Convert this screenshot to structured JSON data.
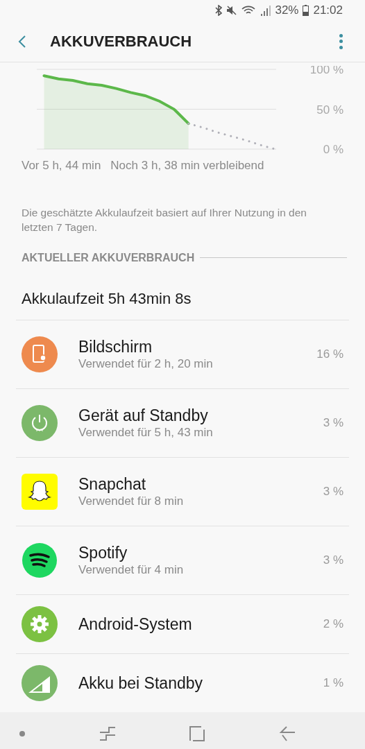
{
  "status_bar": {
    "battery": "32%",
    "time": "21:02"
  },
  "header": {
    "title": "AKKUVERBRAUCH"
  },
  "chart": {
    "chart_data": {
      "type": "line",
      "ylim": [
        0,
        100
      ],
      "yticks": [
        {
          "value": 100,
          "label": "100 %"
        },
        {
          "value": 50,
          "label": "50 %"
        },
        {
          "value": 0,
          "label": "0 %"
        }
      ],
      "series": [
        {
          "color": "#5cb84a",
          "values": [
            92,
            88,
            86,
            82,
            80,
            76,
            71,
            67,
            60,
            50,
            32,
            null,
            null,
            null,
            null,
            null,
            null
          ]
        },
        {
          "color": "#b0b0b8",
          "line_style": "dotted",
          "values": [
            null,
            null,
            null,
            null,
            null,
            null,
            null,
            null,
            null,
            null,
            32,
            27,
            21,
            16,
            11,
            5,
            0
          ]
        }
      ]
    },
    "start_label": "Vor 5 h, 44 min",
    "end_label": "Noch 3 h, 38 min verbleibend"
  },
  "note": "Die geschätzte Akkulaufzeit basiert auf Ihrer Nutzung in den letzten 7 Tagen.",
  "section_title": "AKTUELLER AKKUVERBRAUCH",
  "runtime": "Akkulaufzeit 5h 43min 8s",
  "apps": [
    {
      "kind": "display",
      "name": "Bildschirm",
      "usage": "Verwendet für 2 h, 20 min",
      "percent": "16 %"
    },
    {
      "kind": "power",
      "name": "Gerät auf Standby",
      "usage": "Verwendet für 5 h, 43 min",
      "percent": "3 %"
    },
    {
      "kind": "snapchat",
      "name": "Snapchat",
      "usage": "Verwendet für 8 min",
      "percent": "3 %"
    },
    {
      "kind": "spotify",
      "name": "Spotify",
      "usage": "Verwendet für 4 min",
      "percent": "3 %"
    },
    {
      "kind": "gear",
      "name": "Android-System",
      "percent": "2 %"
    },
    {
      "kind": "signal",
      "name": "Akku bei Standby",
      "percent": "1 %"
    }
  ]
}
